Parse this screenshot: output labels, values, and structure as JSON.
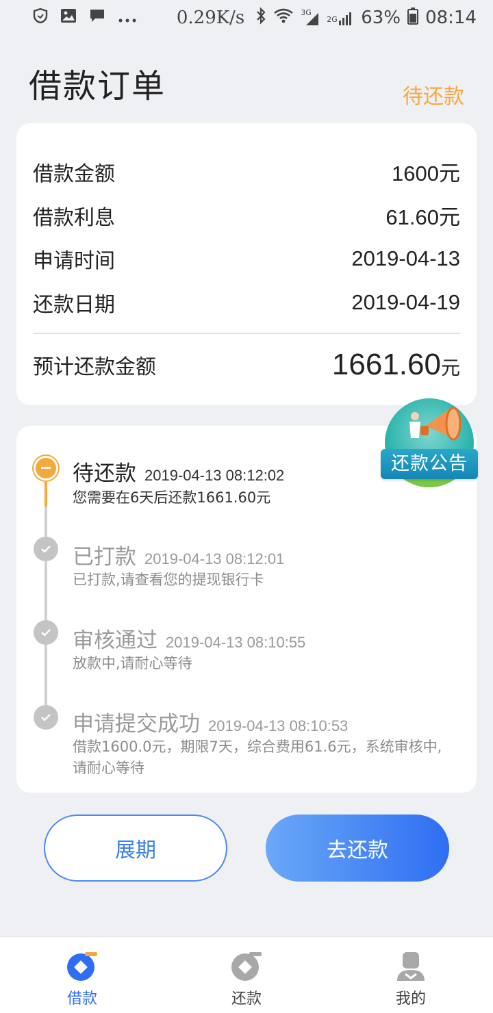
{
  "status_bar": {
    "speed": "0.29K/s",
    "network_3g": "3G",
    "network_2g": "2G",
    "battery": "63%",
    "time": "08:14"
  },
  "header": {
    "title": "借款订单",
    "status": "待还款"
  },
  "summary": {
    "loan_amount_label": "借款金额",
    "loan_amount_value": "1600元",
    "interest_label": "借款利息",
    "interest_value": "61.60元",
    "apply_time_label": "申请时间",
    "apply_time_value": "2019-04-13",
    "repay_date_label": "还款日期",
    "repay_date_value": "2019-04-19",
    "total_label": "预计还款金额",
    "total_value": "1661.60",
    "total_unit": "元"
  },
  "notice": {
    "label": "还款公告"
  },
  "timeline": [
    {
      "title": "待还款",
      "time": "2019-04-13 08:12:02",
      "desc": "您需要在6天后还款1661.60元"
    },
    {
      "title": "已打款",
      "time": "2019-04-13 08:12:01",
      "desc": "已打款,请查看您的提现银行卡"
    },
    {
      "title": "审核通过",
      "time": "2019-04-13 08:10:55",
      "desc": "放款中,请耐心等待"
    },
    {
      "title": "申请提交成功",
      "time": "2019-04-13 08:10:53",
      "desc": "借款1600.0元，期限7天，综合费用61.6元，系统审核中,请耐心等待"
    }
  ],
  "actions": {
    "extend_label": "展期",
    "repay_label": "去还款"
  },
  "nav": [
    {
      "label": "借款",
      "icon": "loan-icon"
    },
    {
      "label": "还款",
      "icon": "repay-icon"
    },
    {
      "label": "我的",
      "icon": "profile-icon"
    }
  ],
  "colors": {
    "accent_orange": "#f6a93b",
    "accent_blue": "#2f6ef2",
    "background": "#eef0f4"
  }
}
